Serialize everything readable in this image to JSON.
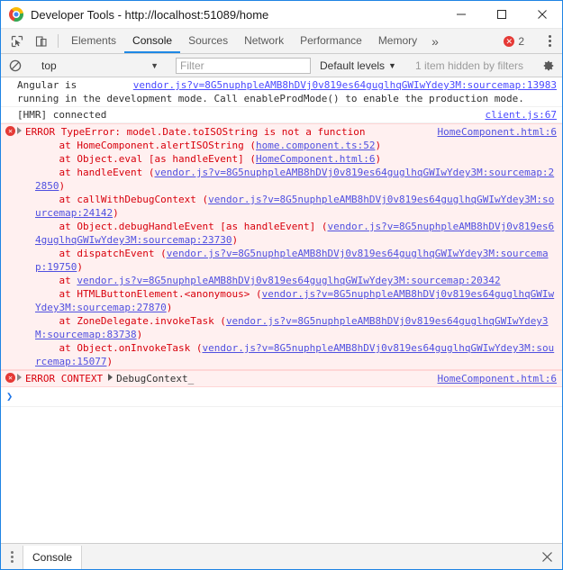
{
  "window": {
    "title": "Developer Tools - http://localhost:51089/home",
    "logo_icon": "chrome-logo",
    "minimize_label": "—",
    "maximize_label": "☐",
    "close_label": "✕"
  },
  "tabstrip": {
    "inspect_icon": "inspect-element-icon",
    "device_icon": "device-toolbar-icon",
    "tabs": [
      {
        "label": "Elements",
        "active": false
      },
      {
        "label": "Console",
        "active": true
      },
      {
        "label": "Sources",
        "active": false
      },
      {
        "label": "Network",
        "active": false
      },
      {
        "label": "Performance",
        "active": false
      },
      {
        "label": "Memory",
        "active": false
      }
    ],
    "more_label": "»",
    "error_count": "2",
    "error_icon": "error-badge-icon",
    "menu_icon": "more-options-icon"
  },
  "console_toolbar": {
    "clear_icon": "clear-console-icon",
    "context_value": "top",
    "context_caret": "▼",
    "filter_placeholder": "Filter",
    "filter_value": "",
    "levels_label": "Default levels",
    "levels_caret": "▼",
    "hidden_note": "1 item hidden by filters",
    "settings_icon": "gear-icon"
  },
  "messages": [
    {
      "type": "info",
      "text_before": "Angular is ",
      "link_inline": "vendor.js?v=8G5nuphpleAMB8hDVj0v819es64guglhqGWIwYdey3M:sourcemap:13983",
      "text_after": "running in the development mode. Call enableProdMode() to enable the production mode."
    },
    {
      "type": "info",
      "text": "[HMR] connected",
      "source": "client.js:67"
    }
  ],
  "error_message": {
    "icon": "error-circle-icon",
    "toggle_icon": "disclosure-triangle-icon",
    "title": "ERROR TypeError: model.Date.toISOString is not a function",
    "source": "HomeComponent.html:6",
    "stack": [
      {
        "prefix": "    at HomeComponent.alertISOString (",
        "link": "home.component.ts:52",
        "suffix": ")"
      },
      {
        "prefix": "    at Object.eval [as handleEvent] (",
        "link": "HomeComponent.html:6",
        "suffix": ")"
      },
      {
        "prefix": "    at handleEvent (",
        "link": "vendor.js?v=8G5nuphpleAMB8hDVj0v819es64guglhqGWIwYdey3M:sourcemap:22850",
        "suffix": ")"
      },
      {
        "prefix": "    at callWithDebugContext (",
        "link": "vendor.js?v=8G5nuphpleAMB8hDVj0v819es64guglhqGWIwYdey3M:sourcemap:24142",
        "suffix": ")"
      },
      {
        "prefix": "    at Object.debugHandleEvent [as handleEvent] (",
        "link": "vendor.js?v=8G5nuphpleAMB8hDVj0v819es64guglhqGWIwYdey3M:sourcemap:23730",
        "suffix": ")"
      },
      {
        "prefix": "    at dispatchEvent (",
        "link": "vendor.js?v=8G5nuphpleAMB8hDVj0v819es64guglhqGWIwYdey3M:sourcemap:19750",
        "suffix": ")"
      },
      {
        "prefix": "    at ",
        "link": "vendor.js?v=8G5nuphpleAMB8hDVj0v819es64guglhqGWIwYdey3M:sourcemap:20342",
        "suffix": ""
      },
      {
        "prefix": "    at HTMLButtonElement.<anonymous> (",
        "link": "vendor.js?v=8G5nuphpleAMB8hDVj0v819es64guglhqGWIwYdey3M:sourcemap:27870",
        "suffix": ")"
      },
      {
        "prefix": "    at ZoneDelegate.invokeTask (",
        "link": "vendor.js?v=8G5nuphpleAMB8hDVj0v819es64guglhqGWIwYdey3M:sourcemap:83738",
        "suffix": ")"
      },
      {
        "prefix": "    at Object.onInvokeTask (",
        "link": "vendor.js?v=8G5nuphpleAMB8hDVj0v819es64guglhqGWIwYdey3M:sourcemap:15077",
        "suffix": ")"
      }
    ]
  },
  "error_context": {
    "icon": "error-circle-icon",
    "toggle_icon": "disclosure-triangle-icon",
    "label": "ERROR CONTEXT",
    "value_toggle": "▶",
    "value": "DebugContext_",
    "source": "HomeComponent.html:6"
  },
  "prompt": {
    "chevron": "❯"
  },
  "drawer": {
    "menu_icon": "drawer-menu-icon",
    "tab_label": "Console",
    "close_icon": "close-icon"
  },
  "colors": {
    "accent": "#1e88e5",
    "error_red": "#e53935",
    "error_bg": "#fff0f0",
    "link_blue": "#5050e0"
  }
}
